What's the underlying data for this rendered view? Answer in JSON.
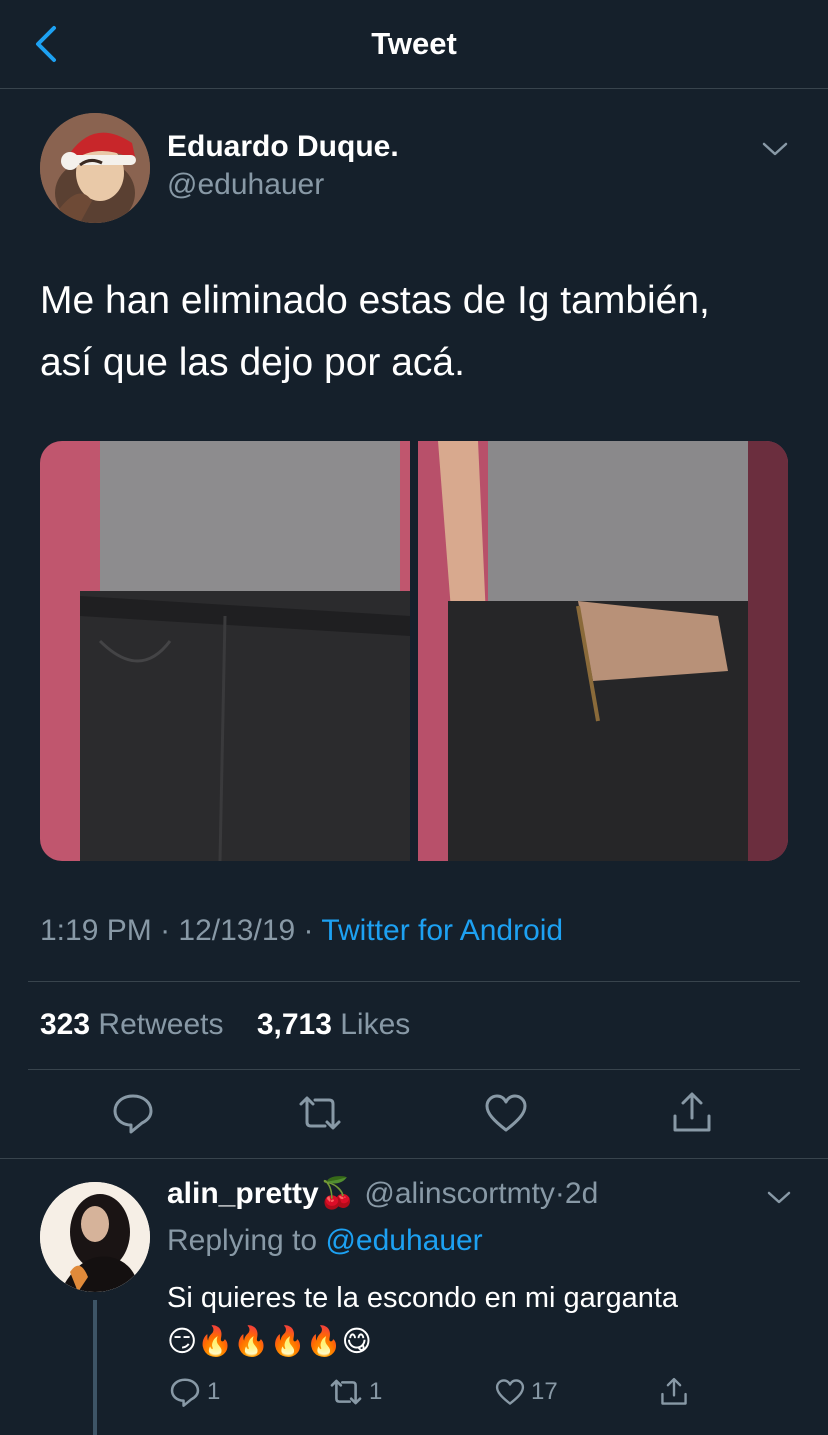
{
  "header": {
    "title": "Tweet",
    "back_icon": "chevron-left-icon"
  },
  "colors": {
    "background": "#15202b",
    "accent": "#1da1f2",
    "secondary_text": "#8899a6",
    "divider": "#38444d"
  },
  "tweet": {
    "author_name": "Eduardo Duque.",
    "author_handle": "@eduhauer",
    "text_line1": "Me han eliminado estas de Ig también,",
    "text_line2": "así que las dejo por acá.",
    "time": "1:19 PM",
    "date": "12/13/19",
    "source": "Twitter for Android",
    "separator": "·",
    "retweets_count": "323",
    "retweets_label": "Retweets",
    "likes_count": "3,713",
    "likes_label": "Likes",
    "media_count": 2
  },
  "reply": {
    "name": "alin_pretty🍒",
    "handle": "@alinscortmty",
    "separator": "·",
    "time": "2d",
    "replying_label": "Replying to",
    "replying_to": "@eduhauer",
    "text_line1": "Si quieres te la escondo en mi garganta",
    "text_line2": "😏🔥🔥🔥🔥😋",
    "reply_count": "1",
    "retweet_count": "1",
    "like_count": "17"
  }
}
